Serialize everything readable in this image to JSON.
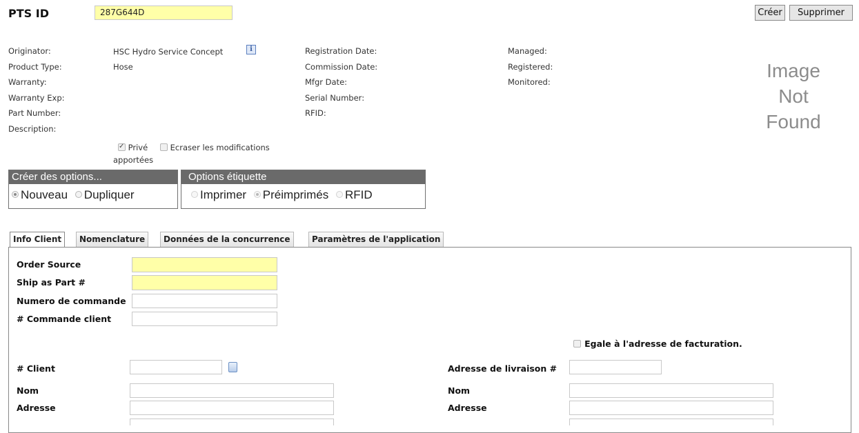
{
  "header": {
    "pts_id_label": "PTS ID",
    "pts_id_value": "287G644D",
    "create_button": "Créer",
    "delete_button": "Supprimer"
  },
  "info": {
    "col1": [
      {
        "label": "Originator:",
        "value": "HSC Hydro Service Concept"
      },
      {
        "label": "Product Type:",
        "value": "Hose"
      },
      {
        "label": "Warranty:",
        "value": ""
      },
      {
        "label": "Warranty Exp:",
        "value": ""
      },
      {
        "label": "Part Number:",
        "value": ""
      },
      {
        "label": "Description:",
        "value": ""
      }
    ],
    "col2": [
      "Registration Date:",
      "Commission Date:",
      "Mfgr Date:",
      "Serial Number:",
      "RFID:"
    ],
    "col3": [
      "Managed:",
      "Registered:",
      "Monitored:"
    ],
    "info_icon": "info-icon"
  },
  "image_placeholder": [
    "Image",
    "Not",
    "Found"
  ],
  "checks": {
    "prive": {
      "label": "Privé",
      "checked": true
    },
    "ecraser": {
      "label_line1": "Ecraser les modifications",
      "label_line2": "apportées",
      "checked": false
    }
  },
  "create_options": {
    "title": "Créer des options...",
    "options": [
      {
        "label": "Nouveau",
        "selected": true
      },
      {
        "label": "Dupliquer",
        "selected": false
      }
    ]
  },
  "label_options": {
    "title": "Options étiquette",
    "options": [
      {
        "label": "Imprimer",
        "selected": false
      },
      {
        "label": "Préimprimés",
        "selected": true
      },
      {
        "label": "RFID",
        "selected": false
      }
    ]
  },
  "tabs": [
    {
      "label": "Info Client",
      "active": true
    },
    {
      "label": "Nomenclature",
      "active": false
    },
    {
      "label": "Données de la concurrence",
      "active": false
    },
    {
      "label": "Paramètres de l'application",
      "active": false
    }
  ],
  "form": {
    "order_source": "Order Source",
    "ship_as_part": "Ship as Part #",
    "numero_commande": "Numero de commande",
    "commande_client": "# Commande client",
    "same_billing": "Egale à l'adresse de facturation.",
    "client_num": "# Client",
    "nom_left": "Nom",
    "adresse_left": "Adresse",
    "delivery_num": "Adresse de livraison #",
    "nom_right": "Nom",
    "adresse_right": "Adresse"
  },
  "colors": {
    "required_field": "#ffffa8",
    "group_header": "#6a6a6a",
    "image_text": "#8c8c8c",
    "info_icon": "#5b7fbf"
  }
}
